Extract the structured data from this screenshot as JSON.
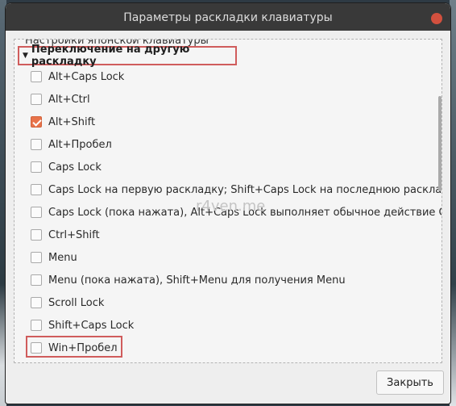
{
  "window": {
    "title": "Параметры раскладки клавиатуры",
    "watermark": "r4ven.me"
  },
  "content": {
    "previous_section_cut": "Настройки японской клавиатуры",
    "section": {
      "label": "Переключение на другую раскладку",
      "expanded": true
    },
    "options": [
      {
        "label": "Alt+Caps Lock",
        "checked": false
      },
      {
        "label": "Alt+Ctrl",
        "checked": false
      },
      {
        "label": "Alt+Shift",
        "checked": true
      },
      {
        "label": "Alt+Пробел",
        "checked": false
      },
      {
        "label": "Caps Lock",
        "checked": false
      },
      {
        "label": "Caps Lock на первую раскладку; Shift+Caps Lock на последнюю раскладку",
        "checked": false
      },
      {
        "label": "Caps Lock (пока нажата), Alt+Caps Lock выполняет обычное действие Caps Lock",
        "checked": false
      },
      {
        "label": "Ctrl+Shift",
        "checked": false
      },
      {
        "label": "Menu",
        "checked": false
      },
      {
        "label": "Menu (пока нажата), Shift+Menu для получения Menu",
        "checked": false
      },
      {
        "label": "Scroll Lock",
        "checked": false
      },
      {
        "label": "Shift+Caps Lock",
        "checked": false
      },
      {
        "label": "Win+Пробел",
        "checked": false
      }
    ]
  },
  "footer": {
    "close_label": "Закрыть"
  },
  "colors": {
    "accent": "#e8734a",
    "highlight_frame": "#d05c5c",
    "titlebar": "#393939"
  }
}
